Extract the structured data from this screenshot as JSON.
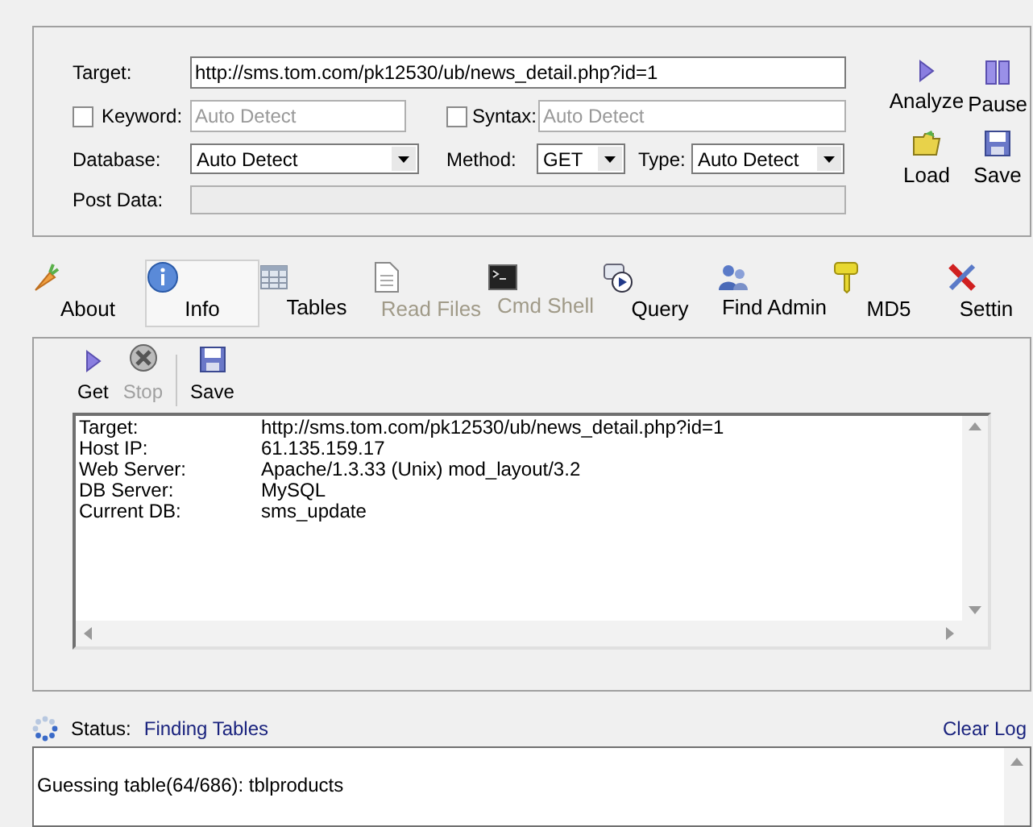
{
  "form": {
    "target": {
      "label": "Target:",
      "value": "http://sms.tom.com/pk12530/ub/news_detail.php?id=1"
    },
    "keyword": {
      "label": "Keyword:",
      "checked": false,
      "placeholder": "Auto Detect"
    },
    "syntax": {
      "label": "Syntax:",
      "checked": false,
      "placeholder": "Auto Detect"
    },
    "database": {
      "label": "Database:",
      "value": "Auto Detect"
    },
    "method": {
      "label": "Method:",
      "value": "GET"
    },
    "type": {
      "label": "Type:",
      "value": "Auto Detect"
    },
    "post_data": {
      "label": "Post Data:",
      "disabled": true
    }
  },
  "actions": [
    {
      "label": "Analyze",
      "kind": "play"
    },
    {
      "label": "Pause",
      "kind": "pause"
    },
    {
      "label": "Load",
      "kind": "folder"
    },
    {
      "label": "Save",
      "kind": "disk"
    }
  ],
  "tabs": [
    {
      "label": "About",
      "kind": "carrot",
      "selected": false,
      "disabled": false
    },
    {
      "label": "Info",
      "kind": "info",
      "selected": true,
      "disabled": false
    },
    {
      "label": "Tables",
      "kind": "table",
      "selected": false,
      "disabled": false
    },
    {
      "label": "Read Files",
      "kind": "file",
      "selected": false,
      "disabled": true
    },
    {
      "label": "Cmd Shell",
      "kind": "terminal",
      "selected": false,
      "disabled": true
    },
    {
      "label": "Query",
      "kind": "query",
      "selected": false,
      "disabled": false
    },
    {
      "label": "Find Admin",
      "kind": "users",
      "selected": false,
      "disabled": false
    },
    {
      "label": "MD5",
      "kind": "key",
      "selected": false,
      "disabled": false
    },
    {
      "label": "Settin",
      "kind": "tools",
      "selected": false,
      "disabled": false
    }
  ],
  "toolbar": [
    {
      "label": "Get",
      "kind": "play",
      "disabled": false
    },
    {
      "label": "Stop",
      "kind": "stop",
      "disabled": true
    },
    {
      "label": "Save",
      "kind": "disk",
      "disabled": false
    }
  ],
  "info": [
    {
      "key": "Target:",
      "value": "http://sms.tom.com/pk12530/ub/news_detail.php?id=1"
    },
    {
      "key": "Host IP:",
      "value": "61.135.159.17"
    },
    {
      "key": "Web Server:",
      "value": "Apache/1.3.33 (Unix) mod_layout/3.2"
    },
    {
      "key": "DB Server:",
      "value": "MySQL"
    },
    {
      "key": "Current DB:",
      "value": "sms_update"
    }
  ],
  "status": {
    "label": "Status:",
    "value": "Finding Tables"
  },
  "clear_log": "Clear Log",
  "log": [
    "Guessing table(64/686): tblproducts"
  ]
}
